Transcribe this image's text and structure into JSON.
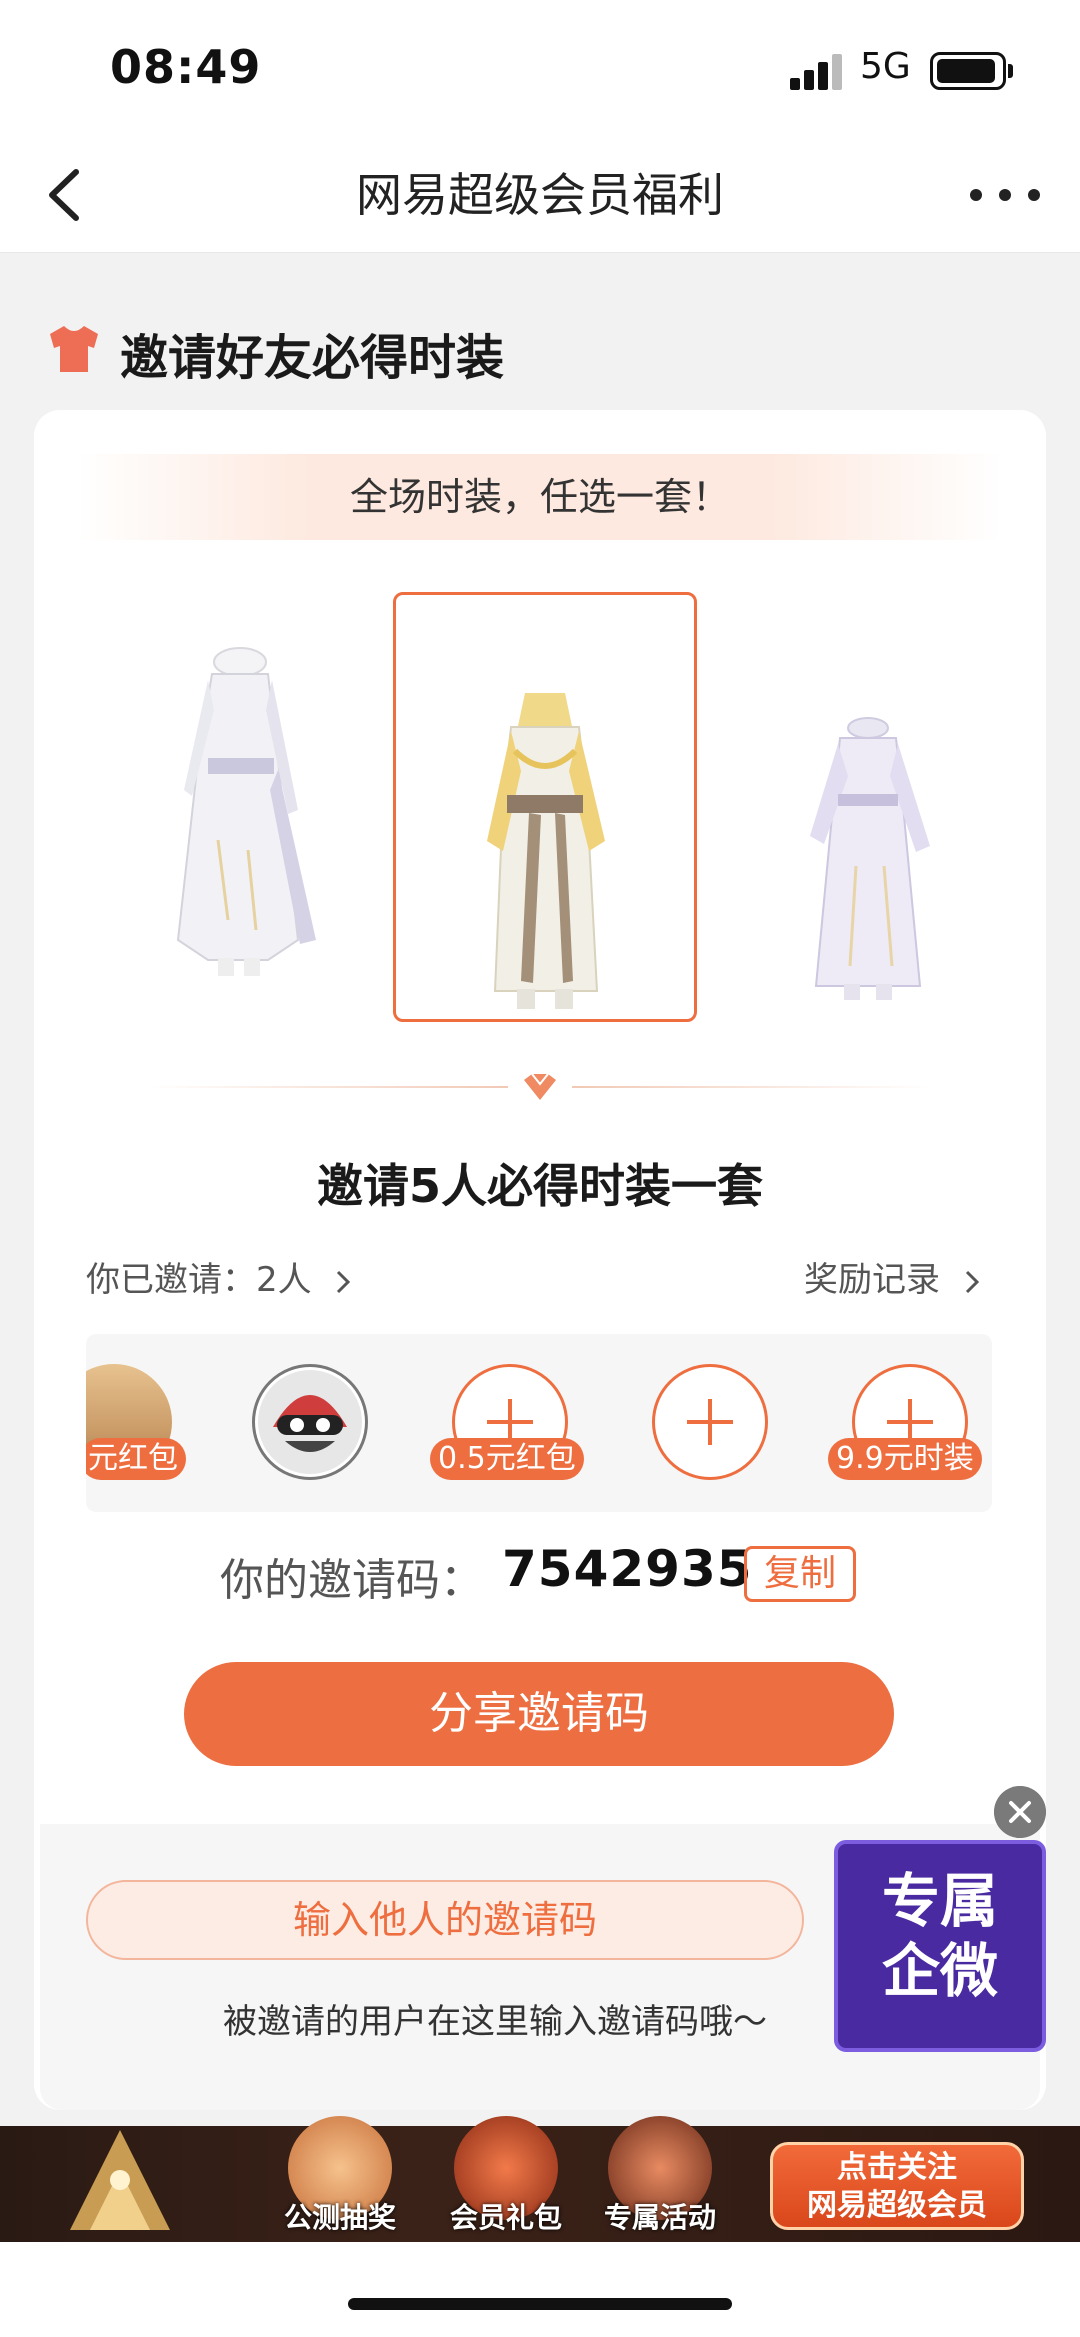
{
  "status_bar": {
    "time": "08:49",
    "network": "5G"
  },
  "nav": {
    "title": "网易超级会员福利"
  },
  "section": {
    "title": "邀请好友必得时装"
  },
  "card": {
    "banner": "全场时装，任选一套！",
    "outfits": [
      {
        "name": "outfit-white-silver",
        "selected": false
      },
      {
        "name": "outfit-white-gold",
        "selected": true
      },
      {
        "name": "outfit-lavender",
        "selected": false
      }
    ],
    "invite_title": "邀请5人必得时装一套",
    "invited_label": "你已邀请：2人",
    "records_label": "奖励记录",
    "slots": [
      {
        "filled": true,
        "badge": "元红包",
        "icon": "avatar-landscape"
      },
      {
        "filled": true,
        "badge": "",
        "icon": "avatar-ninja"
      },
      {
        "filled": false,
        "badge": "0.5元红包",
        "icon": "plus-icon"
      },
      {
        "filled": false,
        "badge": "",
        "icon": "plus-icon"
      },
      {
        "filled": false,
        "badge": "9.9元时装",
        "icon": "plus-icon"
      }
    ],
    "code_label": "你的邀请码：",
    "code_value": "7542935",
    "copy_label": "复制",
    "share_label": "分享邀请码",
    "enter_code_label": "输入他人的邀请码",
    "hint": "被邀请的用户在这里输入邀请码哦～"
  },
  "float_widget": {
    "line1": "专属",
    "line2": "企微"
  },
  "bottom_banner": {
    "items": [
      "公测抽奖",
      "会员礼包",
      "专属活动"
    ],
    "follow_line1": "点击关注",
    "follow_line2": "网易超级会员"
  },
  "colors": {
    "accent": "#ed6e41",
    "widget": "#4a2aa0"
  }
}
